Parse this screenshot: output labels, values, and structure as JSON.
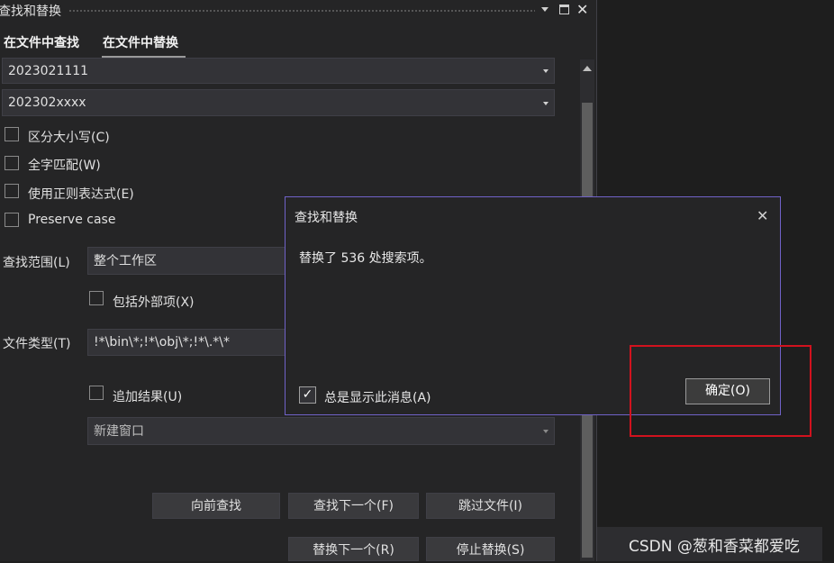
{
  "panel": {
    "title": "查找和替换",
    "title_icons": [
      "dropdown-arrow-icon",
      "maximize-icon",
      "close-icon"
    ],
    "tabs": [
      {
        "label": "在文件中查找",
        "active": false
      },
      {
        "label": "在文件中替换",
        "active": true
      }
    ],
    "find_value": "2023021111",
    "replace_value": "202302xxxx",
    "options": {
      "match_case": "区分大小写(C)",
      "whole_word": "全字匹配(W)",
      "regex": "使用正则表达式(E)",
      "preserve_case": "Preserve case"
    },
    "scope_label": "查找范围(L)",
    "scope_value": "整个工作区",
    "include_external": "包括外部项(X)",
    "file_types_label": "文件类型(T)",
    "file_types_value": "!*\\bin\\*;!*\\obj\\*;!*\\.*\\*",
    "append_results": "追加结果(U)",
    "result_window": "新建窗口",
    "buttons": {
      "find_previous": "向前查找",
      "find_next": "查找下一个(F)",
      "skip_file": "跳过文件(I)",
      "replace_next": "替换下一个(R)",
      "stop_replace": "停止替换(S)"
    }
  },
  "dialog": {
    "title": "查找和替换",
    "message": "替换了 536 处搜索项。",
    "always_show_label": "总是显示此消息(A)",
    "always_show_checked": true,
    "ok_label": "确定(O)"
  },
  "watermark": "CSDN @葱和香菜都爱吃",
  "colors": {
    "dialog_border": "#7062c8",
    "highlight_box": "#d1121e",
    "panel_bg": "#252526"
  }
}
